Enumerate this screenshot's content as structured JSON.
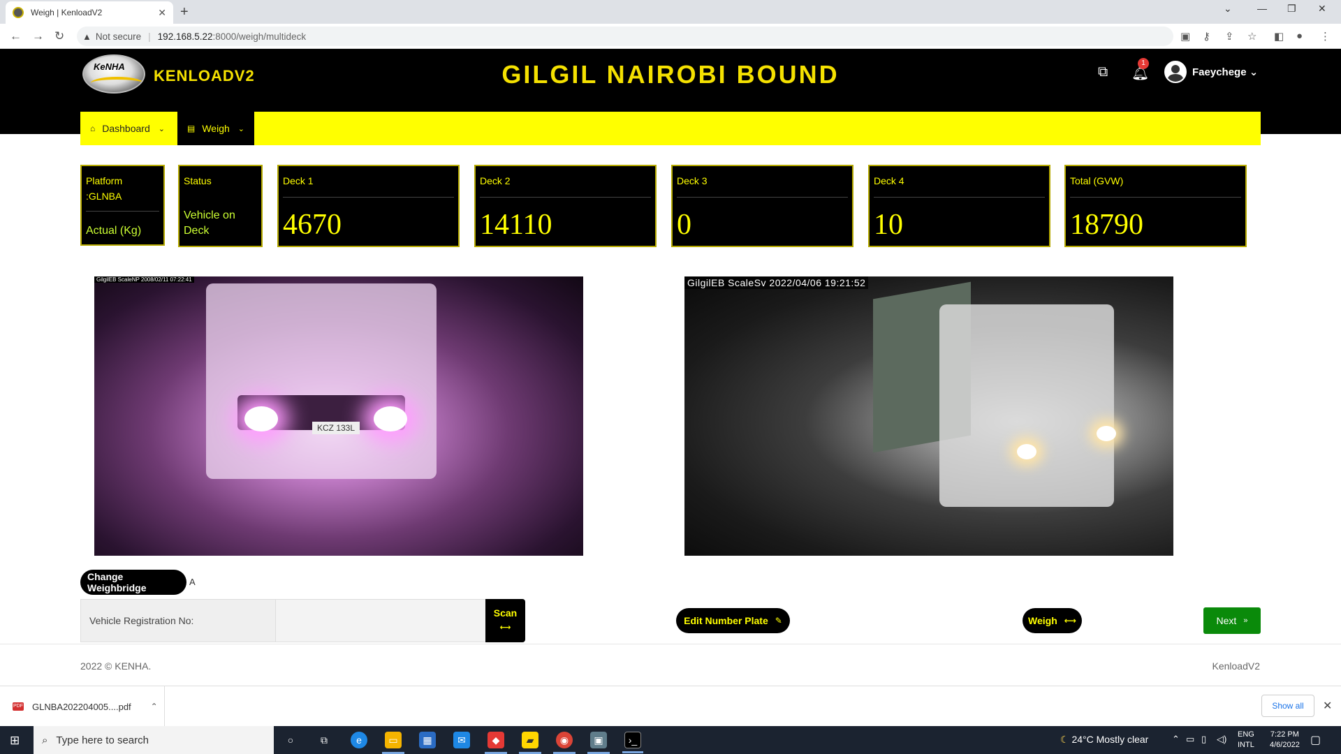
{
  "browser": {
    "tab_title": "Weigh | KenloadV2",
    "tab_close": "✕",
    "new_tab": "+",
    "security": "Not secure",
    "url_host": "192.168.5.22",
    "url_path": ":8000/weigh/multideck"
  },
  "app": {
    "logo_text": "KeNHA",
    "brand": "KENLOADV2",
    "station_title": "GILGIL NAIROBI BOUND",
    "notification_count": "1",
    "user_name": "Faeychege",
    "user_caret": "⌄"
  },
  "menu": [
    {
      "label": "Dashboard",
      "icon": "home-icon",
      "active": false
    },
    {
      "label": "Weigh",
      "icon": "scale-icon",
      "active": true
    }
  ],
  "stats": {
    "platform_label": "Platform",
    "platform_value": ":GLNBA",
    "platform_unit": "Actual (Kg)",
    "status_label": "Status",
    "status_value": "Vehicle on Deck",
    "decks": [
      {
        "label": "Deck 1",
        "value": "4670"
      },
      {
        "label": "Deck 2",
        "value": "14110"
      },
      {
        "label": "Deck 3",
        "value": "0"
      },
      {
        "label": "Deck 4",
        "value": "10"
      },
      {
        "label": "Total (GVW)",
        "value": "18790"
      }
    ]
  },
  "cameras": {
    "cam1_stamp": "GilgilEB ScaleNP 2008/02/11 07:22:41",
    "cam1_plate": "KCZ 133L",
    "cam2_stamp": "GilgilEB ScaleSv 2022/04/06 19:21:52"
  },
  "controls": {
    "change_weighbridge": "Change Weighbridge",
    "weighbridge_suffix": "A",
    "reg_label": "Vehicle Registration No:",
    "reg_value": "",
    "scan_label": "Scan",
    "edit_plate_label": "Edit Number Plate",
    "weigh_label": "Weigh",
    "next_label": "Next"
  },
  "footer": {
    "copyright": "2022 © KENHA.",
    "app_name": "KenloadV2"
  },
  "downloads": {
    "file_name": "GLNBA202204005....pdf",
    "file_type": "PDF",
    "show_all": "Show all"
  },
  "taskbar": {
    "search_placeholder": "Type here to search",
    "weather_temp": "24°C",
    "weather_desc": "Mostly clear",
    "lang_line1": "ENG",
    "lang_line2": "INTL",
    "time": "7:22 PM",
    "date": "4/6/2022"
  },
  "colors": {
    "accent_yellow": "#ffff00",
    "header_black": "#000000",
    "next_green": "#0a8a0a"
  }
}
